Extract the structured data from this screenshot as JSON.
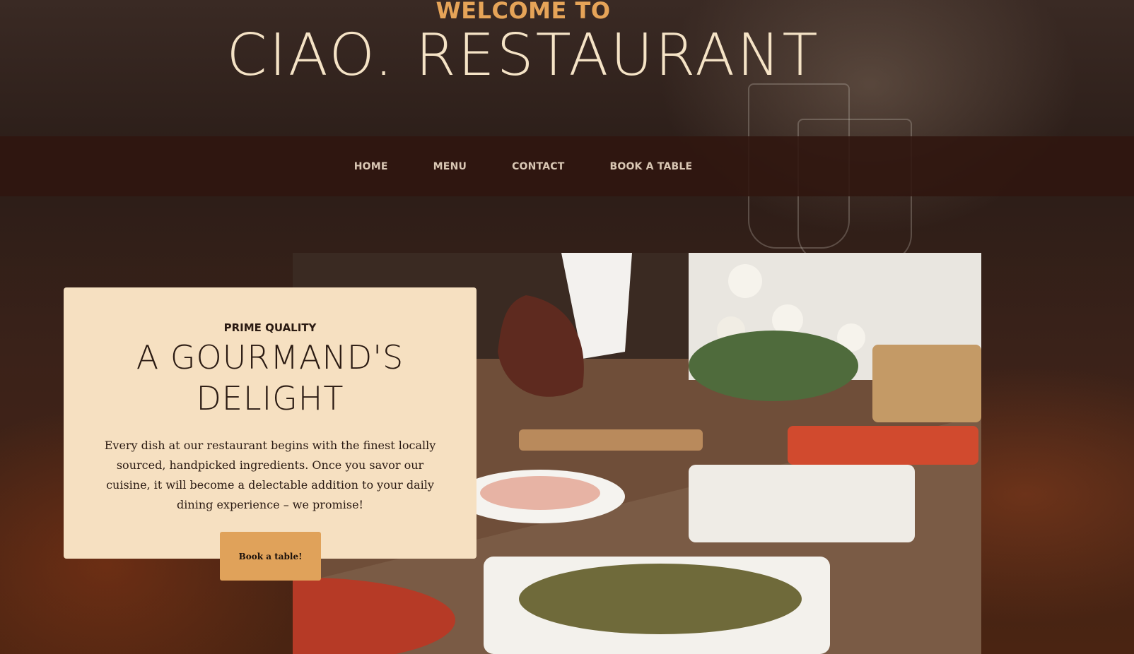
{
  "header": {
    "welcome": "WELCOME TO",
    "brand": "CIAO. RESTAURANT"
  },
  "nav": {
    "items": [
      {
        "label": "HOME"
      },
      {
        "label": "MENU"
      },
      {
        "label": "CONTACT"
      },
      {
        "label": "BOOK A TABLE"
      }
    ]
  },
  "feature": {
    "eyebrow": "PRIME QUALITY",
    "title": "A GOURMAND'S DELIGHT",
    "body": "Every dish at our restaurant begins with the finest locally sourced, handpicked ingredients. Once you savor our cuisine, it will become a delectable addition to your daily dining experience – we promise!",
    "cta_label": "Book a table!"
  },
  "colors": {
    "accent": "#e6a458",
    "card_bg": "#f6e0c1",
    "nav_bg": "#30160f",
    "button_bg": "#e0a25a"
  }
}
